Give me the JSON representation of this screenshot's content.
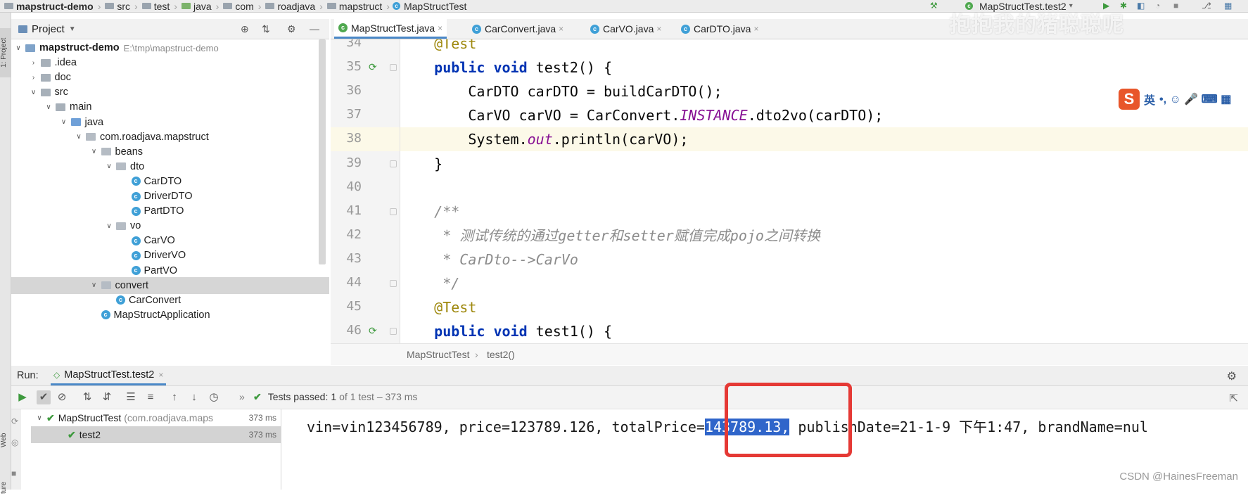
{
  "topbar": {
    "crumbs": [
      {
        "label": "mapstruct-demo",
        "bold": true
      },
      {
        "label": "src"
      },
      {
        "label": "test"
      },
      {
        "label": "java"
      },
      {
        "label": "com"
      },
      {
        "label": "roadjava"
      },
      {
        "label": "mapstruct"
      },
      {
        "label": "MapStructTest"
      }
    ],
    "run_config": "MapStructTest.test2",
    "watermark": "抱抱我的猪聪聪呢"
  },
  "left_stripe": {
    "project_label": "1: Project",
    "web_label": "Web",
    "structure_label": "ture"
  },
  "project": {
    "title": "Project",
    "tree": [
      {
        "label": "mapstruct-demo",
        "path": "E:\\tmp\\mapstruct-demo",
        "icon": "module-folder",
        "depth": 0,
        "arrow": "down"
      },
      {
        "label": ".idea",
        "icon": "folder",
        "depth": 1,
        "arrow": "right"
      },
      {
        "label": "doc",
        "icon": "folder",
        "depth": 1,
        "arrow": "right"
      },
      {
        "label": "src",
        "icon": "folder",
        "depth": 1,
        "arrow": "down"
      },
      {
        "label": "main",
        "icon": "folder",
        "depth": 2,
        "arrow": "down"
      },
      {
        "label": "java",
        "icon": "source-folder",
        "depth": 3,
        "arrow": "down"
      },
      {
        "label": "com.roadjava.mapstruct",
        "icon": "package",
        "depth": 4,
        "arrow": "down"
      },
      {
        "label": "beans",
        "icon": "package",
        "depth": 5,
        "arrow": "down"
      },
      {
        "label": "dto",
        "icon": "package",
        "depth": 6,
        "arrow": "down"
      },
      {
        "label": "CarDTO",
        "icon": "class",
        "depth": 7,
        "arrow": ""
      },
      {
        "label": "DriverDTO",
        "icon": "class",
        "depth": 7,
        "arrow": ""
      },
      {
        "label": "PartDTO",
        "icon": "class",
        "depth": 7,
        "arrow": ""
      },
      {
        "label": "vo",
        "icon": "package",
        "depth": 6,
        "arrow": "down"
      },
      {
        "label": "CarVO",
        "icon": "class",
        "depth": 7,
        "arrow": ""
      },
      {
        "label": "DriverVO",
        "icon": "class",
        "depth": 7,
        "arrow": ""
      },
      {
        "label": "PartVO",
        "icon": "class",
        "depth": 7,
        "arrow": ""
      },
      {
        "label": "convert",
        "icon": "package",
        "depth": 5,
        "arrow": "down",
        "selected": true
      },
      {
        "label": "CarConvert",
        "icon": "class",
        "depth": 6,
        "arrow": ""
      },
      {
        "label": "MapStructApplication",
        "icon": "class",
        "depth": 5,
        "arrow": ""
      }
    ]
  },
  "editor": {
    "tabs": [
      {
        "label": "MapStructTest.java",
        "active": true
      },
      {
        "label": "CarConvert.java"
      },
      {
        "label": "CarVO.java"
      },
      {
        "label": "CarDTO.java"
      }
    ],
    "lines": [
      {
        "num": "34",
        "text": "    @Test"
      },
      {
        "num": "35",
        "text": "    public void test2() {"
      },
      {
        "num": "36",
        "text": "        CarDTO carDTO = buildCarDTO();"
      },
      {
        "num": "37",
        "text": "        CarVO carVO = CarConvert.INSTANCE.dto2vo(carDTO);"
      },
      {
        "num": "38",
        "text": "        System.out.println(carVO);",
        "current": true
      },
      {
        "num": "39",
        "text": "    }"
      },
      {
        "num": "40",
        "text": ""
      },
      {
        "num": "41",
        "text": "    /**"
      },
      {
        "num": "42",
        "text": "     * 测试传统的通过getter和setter赋值完成pojo之间转换"
      },
      {
        "num": "43",
        "text": "     * CarDto-->CarVo"
      },
      {
        "num": "44",
        "text": "     */"
      },
      {
        "num": "45",
        "text": "    @Test"
      },
      {
        "num": "46",
        "text": "    public void test1() {"
      }
    ],
    "breadcrumb": [
      "MapStructTest",
      "test2()"
    ],
    "ime": {
      "logo": "S",
      "lang": "英",
      "symbols": "•, ☺ 🎤 ⌨ ▦"
    }
  },
  "run": {
    "label": "Run:",
    "tab": "MapStructTest.test2",
    "status_prefix": "Tests passed:",
    "status_count": "1",
    "status_rest": "of 1 test – 373 ms",
    "tests": [
      {
        "label": "MapStructTest",
        "detail": "(com.roadjava.maps",
        "time": "373 ms"
      },
      {
        "label": "test2",
        "time": "373 ms",
        "selected": true
      }
    ],
    "console": {
      "before": "vin=vin123456789, price=123789.126, totalPrice=",
      "selected": "143789.13,",
      "after": " publishDate=21-1-9 下午1:47, brandName=nul"
    }
  },
  "footer": {
    "credit": "CSDN @HainesFreeman"
  },
  "colors": {
    "accent": "#4a88c7",
    "highlight_box": "#e53935",
    "selection": "#2f65ca",
    "pass_green": "#3e9a3e"
  }
}
